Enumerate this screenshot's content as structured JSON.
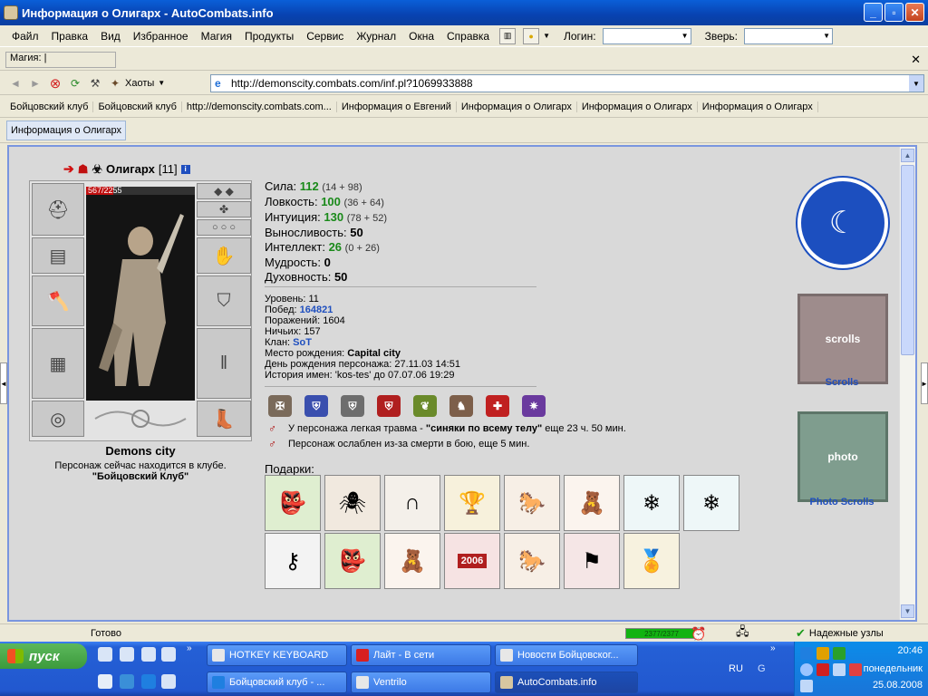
{
  "window": {
    "title": "Информация о Олигарх - AutoCombats.info"
  },
  "menu": {
    "items": [
      "Файл",
      "Правка",
      "Вид",
      "Избранное",
      "Магия",
      "Продукты",
      "Сервис",
      "Журнал",
      "Окна",
      "Справка"
    ],
    "login_label": "Логин:",
    "beast_label": "Зверь:"
  },
  "magic_bar": {
    "label": "Магия:"
  },
  "nav": {
    "chaos_label": "Хаоты",
    "url": "http://demonscity.combats.com/inf.pl?1069933888"
  },
  "links": [
    "Бойцовский клуб",
    "Бойцовский клуб",
    "http://demonscity.combats.com...",
    "Информация о Евгений",
    "Информация о Олигарх",
    "Информация о Олигарх",
    "Информация о Олигарх"
  ],
  "active_tab": "Информация о Олигарх",
  "character": {
    "name": "Олигарх",
    "level_tag": "[11]",
    "hp": "567/2255",
    "hp_fraction": 0.2514,
    "city": "Demons city",
    "location_note": "Персонаж сейчас находится в клубе.",
    "location_club": "\"Бойцовский Клуб\""
  },
  "stats": [
    {
      "name": "Сила:",
      "value": "112",
      "extra": "(14 + 98)",
      "green": true
    },
    {
      "name": "Ловкость:",
      "value": "100",
      "extra": "(36 + 64)",
      "green": true
    },
    {
      "name": "Интуиция:",
      "value": "130",
      "extra": "(78 + 52)",
      "green": true
    },
    {
      "name": "Выносливость:",
      "value": "50",
      "extra": "",
      "green": false
    },
    {
      "name": "Интеллект:",
      "value": "26",
      "extra": "(0 + 26)",
      "green": true
    },
    {
      "name": "Мудрость:",
      "value": "0",
      "extra": "",
      "green": false
    },
    {
      "name": "Духовность:",
      "value": "50",
      "extra": "",
      "green": false
    }
  ],
  "details": [
    {
      "label": "Уровень: ",
      "value": "11",
      "style": "plain"
    },
    {
      "label": "Побед: ",
      "value": "164821",
      "style": "blue"
    },
    {
      "label": "Поражений: ",
      "value": "1604",
      "style": "plain"
    },
    {
      "label": "Ничьих: ",
      "value": "157",
      "style": "plain"
    },
    {
      "label": "Клан: ",
      "value": "SoT",
      "style": "blue"
    },
    {
      "label": "Место рождения: ",
      "value": "Capital city",
      "style": "bold"
    },
    {
      "label": "День рождения персонажа: ",
      "value": "27.11.03 14:51",
      "style": "plain"
    },
    {
      "label": "История имен: ",
      "value": "'kos-tes' до 07.07.06 19:29",
      "style": "plain"
    }
  ],
  "badges": [
    {
      "icon": "warrior-badge-icon",
      "color": "#7a6a5a"
    },
    {
      "icon": "shield-blue-badge-icon",
      "color": "#3a4fae"
    },
    {
      "icon": "shield-gray-badge-icon",
      "color": "#6d6d6d"
    },
    {
      "icon": "shield-red-badge-icon",
      "color": "#b01f1f"
    },
    {
      "icon": "laurel-badge-icon",
      "color": "#6a8a2a"
    },
    {
      "icon": "knight-badge-icon",
      "color": "#7d5f4a"
    },
    {
      "icon": "red-cross-badge-icon",
      "color": "#c02020"
    },
    {
      "icon": "purple-star-badge-icon",
      "color": "#6a3a9e"
    }
  ],
  "status": [
    {
      "pre": "У персонажа легкая травма - ",
      "bold": "\"синяки по всему телу\"",
      "post": " еще 23 ч. 50 мин."
    },
    {
      "pre": "Персонаж ослаблен из-за смерти в бою, еще 5 мин.",
      "bold": "",
      "post": ""
    }
  ],
  "gifts_label": "Подарки:",
  "gifts_row1": [
    "goblin-gift-icon",
    "spider-gift-icon",
    "horseshoe-gift-icon",
    "trophy-gift-icon",
    "rocking-horse-gift-icon",
    "teddy-bear-gift-icon",
    "ice-crystal-gift-icon",
    "ice-crystal-gift-icon"
  ],
  "gifts_row2": [
    "keychain-gift-icon",
    "goblin-gift-icon",
    "teddy-bear-gift-icon",
    "book-2006-gift-icon",
    "rocking-horse-gift-icon",
    "red-banner-gift-icon",
    "gold-medal-gift-icon"
  ],
  "gift_2006_text": "2006",
  "right_column": {
    "scrolls_label": "Scrolls",
    "photo_scrolls_label": "Photo Scrolls",
    "scrolls_banner_text": "scrolls",
    "photo_banner_text": "photo"
  },
  "statusbar": {
    "ready": "Готово",
    "progress": "2377/2377",
    "trusted": "Надежные узлы"
  },
  "taskbar": {
    "start": "пуск",
    "row1": [
      "HOTKEY KEYBOARD",
      "Лайт - В сети",
      "Новости Бойцовског..."
    ],
    "row2": [
      "Бойцовский клуб - ...",
      "Ventrilo",
      "AutoCombats.info"
    ],
    "lang": "RU",
    "clock_time": "20:46",
    "clock_day": "понедельник",
    "clock_date": "25.08.2008"
  },
  "colors": {
    "accent": "#1f4fbf",
    "green_stat": "#1a8a1a",
    "hp_red": "#c01010"
  }
}
